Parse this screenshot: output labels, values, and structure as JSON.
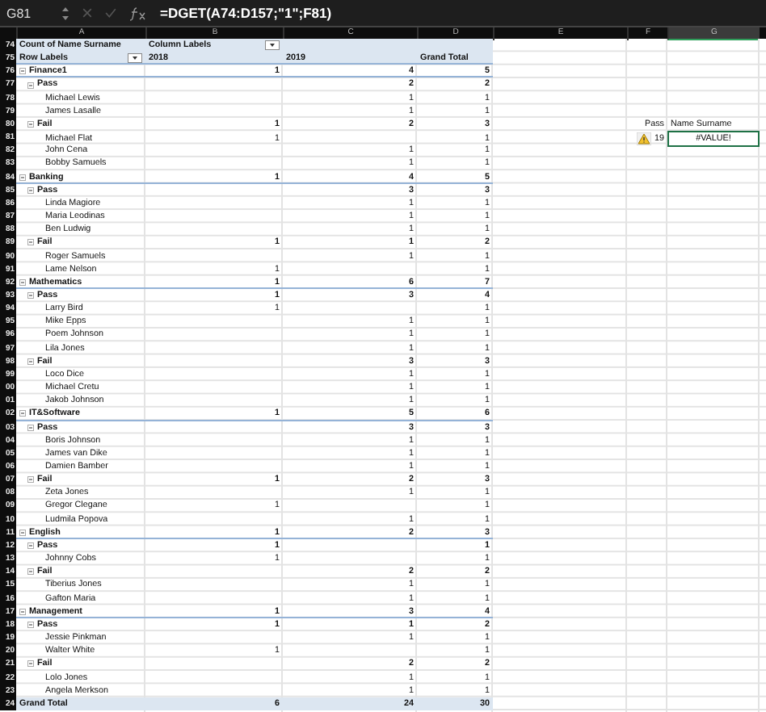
{
  "formula_bar": {
    "name_box": "G81",
    "formula": "=DGET(A74:D157;\"1\";F81)"
  },
  "columns": [
    {
      "label": "A",
      "selected": false
    },
    {
      "label": "B",
      "selected": false
    },
    {
      "label": "C",
      "selected": false
    },
    {
      "label": "D",
      "selected": false
    },
    {
      "label": "E",
      "selected": false
    },
    {
      "label": "F",
      "selected": false
    },
    {
      "label": "G",
      "selected": true
    }
  ],
  "pivot": {
    "header": {
      "row_number": "74",
      "title": "Count of Name Surname",
      "column_labels": "Column Labels"
    },
    "subheader": {
      "row_number": "75",
      "row_labels": "Row Labels",
      "years": [
        "2018",
        "2019"
      ],
      "grand_total": "Grand Total"
    },
    "rows": [
      {
        "row_number": "76",
        "label": "Finance1",
        "expanded": true,
        "values": {
          "y2018": "1",
          "y2019": "4",
          "total": "5"
        },
        "children": [
          {
            "row_number": "77",
            "label": "Pass",
            "expanded": true,
            "values": {
              "y2019": "2",
              "total": "2"
            },
            "children": [
              {
                "row_number": "78",
                "label": "Michael Lewis",
                "values": {
                  "y2019": "1",
                  "total": "1"
                }
              },
              {
                "row_number": "79",
                "label": "James Lasalle",
                "values": {
                  "y2019": "1",
                  "total": "1"
                }
              }
            ]
          },
          {
            "row_number": "80",
            "label": "Fail",
            "expanded": true,
            "values": {
              "y2018": "1",
              "y2019": "2",
              "total": "3"
            },
            "side": {
              "f": "Pass",
              "g": "Name Surname"
            },
            "children": [
              {
                "row_number": "81",
                "label": "Michael Flat",
                "values": {
                  "y2018": "1",
                  "total": "1"
                },
                "side": {
                  "f": "19",
                  "g": "#VALUE!",
                  "warning": true,
                  "selected": true
                }
              },
              {
                "row_number": "82",
                "label": "John Cena",
                "values": {
                  "y2019": "1",
                  "total": "1"
                }
              },
              {
                "row_number": "83",
                "label": "Bobby Samuels",
                "values": {
                  "y2019": "1",
                  "total": "1"
                }
              }
            ]
          }
        ]
      },
      {
        "row_number": "84",
        "label": "Banking",
        "expanded": true,
        "values": {
          "y2018": "1",
          "y2019": "4",
          "total": "5"
        },
        "children": [
          {
            "row_number": "85",
            "label": "Pass",
            "expanded": true,
            "values": {
              "y2019": "3",
              "total": "3"
            },
            "children": [
              {
                "row_number": "86",
                "label": "Linda Magiore",
                "values": {
                  "y2019": "1",
                  "total": "1"
                }
              },
              {
                "row_number": "87",
                "label": "Maria Leodinas",
                "values": {
                  "y2019": "1",
                  "total": "1"
                }
              },
              {
                "row_number": "88",
                "label": "Ben Ludwig",
                "values": {
                  "y2019": "1",
                  "total": "1"
                }
              }
            ]
          },
          {
            "row_number": "89",
            "label": "Fail",
            "expanded": true,
            "values": {
              "y2018": "1",
              "y2019": "1",
              "total": "2"
            },
            "children": [
              {
                "row_number": "90",
                "label": "Roger Samuels",
                "values": {
                  "y2019": "1",
                  "total": "1"
                }
              },
              {
                "row_number": "91",
                "label": "Lame Nelson",
                "values": {
                  "y2018": "1",
                  "total": "1"
                }
              }
            ]
          }
        ]
      },
      {
        "row_number": "92",
        "label": "Mathematics",
        "expanded": true,
        "values": {
          "y2018": "1",
          "y2019": "6",
          "total": "7"
        },
        "children": [
          {
            "row_number": "93",
            "label": "Pass",
            "expanded": true,
            "values": {
              "y2018": "1",
              "y2019": "3",
              "total": "4"
            },
            "children": [
              {
                "row_number": "94",
                "label": "Larry Bird",
                "values": {
                  "y2018": "1",
                  "total": "1"
                }
              },
              {
                "row_number": "95",
                "label": "Mike Epps",
                "values": {
                  "y2019": "1",
                  "total": "1"
                }
              },
              {
                "row_number": "96",
                "label": "Poem Johnson",
                "values": {
                  "y2019": "1",
                  "total": "1"
                }
              },
              {
                "row_number": "97",
                "label": "Lila Jones",
                "values": {
                  "y2019": "1",
                  "total": "1"
                }
              }
            ]
          },
          {
            "row_number": "98",
            "label": "Fail",
            "expanded": true,
            "values": {
              "y2019": "3",
              "total": "3"
            },
            "children": [
              {
                "row_number": "99",
                "label": "Loco Dice",
                "values": {
                  "y2019": "1",
                  "total": "1"
                }
              },
              {
                "row_number": "00",
                "label": "Michael Cretu",
                "values": {
                  "y2019": "1",
                  "total": "1"
                }
              },
              {
                "row_number": "01",
                "label": "Jakob Johnson",
                "values": {
                  "y2019": "1",
                  "total": "1"
                }
              }
            ]
          }
        ]
      },
      {
        "row_number": "02",
        "label": "IT&Software",
        "expanded": true,
        "values": {
          "y2018": "1",
          "y2019": "5",
          "total": "6"
        },
        "children": [
          {
            "row_number": "03",
            "label": "Pass",
            "expanded": true,
            "values": {
              "y2019": "3",
              "total": "3"
            },
            "children": [
              {
                "row_number": "04",
                "label": "Boris Johnson",
                "values": {
                  "y2019": "1",
                  "total": "1"
                }
              },
              {
                "row_number": "05",
                "label": "James van Dike",
                "values": {
                  "y2019": "1",
                  "total": "1"
                }
              },
              {
                "row_number": "06",
                "label": "Damien Bamber",
                "values": {
                  "y2019": "1",
                  "total": "1"
                }
              }
            ]
          },
          {
            "row_number": "07",
            "label": "Fail",
            "expanded": true,
            "values": {
              "y2018": "1",
              "y2019": "2",
              "total": "3"
            },
            "children": [
              {
                "row_number": "08",
                "label": "Zeta Jones",
                "values": {
                  "y2019": "1",
                  "total": "1"
                }
              },
              {
                "row_number": "09",
                "label": "Gregor Clegane",
                "values": {
                  "y2018": "1",
                  "total": "1"
                }
              },
              {
                "row_number": "10",
                "label": "Ludmila Popova",
                "values": {
                  "y2019": "1",
                  "total": "1"
                }
              }
            ]
          }
        ]
      },
      {
        "row_number": "11",
        "label": "English",
        "expanded": true,
        "values": {
          "y2018": "1",
          "y2019": "2",
          "total": "3"
        },
        "children": [
          {
            "row_number": "12",
            "label": "Pass",
            "expanded": true,
            "values": {
              "y2018": "1",
              "total": "1"
            },
            "children": [
              {
                "row_number": "13",
                "label": "Johnny Cobs",
                "values": {
                  "y2018": "1",
                  "total": "1"
                }
              }
            ]
          },
          {
            "row_number": "14",
            "label": "Fail",
            "expanded": true,
            "values": {
              "y2019": "2",
              "total": "2"
            },
            "children": [
              {
                "row_number": "15",
                "label": "Tiberius Jones",
                "values": {
                  "y2019": "1",
                  "total": "1"
                }
              },
              {
                "row_number": "16",
                "label": "Gafton Maria",
                "values": {
                  "y2019": "1",
                  "total": "1"
                }
              }
            ]
          }
        ]
      },
      {
        "row_number": "17",
        "label": "Management",
        "expanded": true,
        "values": {
          "y2018": "1",
          "y2019": "3",
          "total": "4"
        },
        "children": [
          {
            "row_number": "18",
            "label": "Pass",
            "expanded": true,
            "values": {
              "y2018": "1",
              "y2019": "1",
              "total": "2"
            },
            "children": [
              {
                "row_number": "19",
                "label": "Jessie Pinkman",
                "values": {
                  "y2019": "1",
                  "total": "1"
                }
              },
              {
                "row_number": "20",
                "label": "Walter White",
                "values": {
                  "y2018": "1",
                  "total": "1"
                }
              }
            ]
          },
          {
            "row_number": "21",
            "label": "Fail",
            "expanded": true,
            "values": {
              "y2019": "2",
              "total": "2"
            },
            "children": [
              {
                "row_number": "22",
                "label": "Lolo Jones",
                "values": {
                  "y2019": "1",
                  "total": "1"
                }
              },
              {
                "row_number": "23",
                "label": "Angela Merkson",
                "values": {
                  "y2019": "1",
                  "total": "1"
                }
              }
            ]
          }
        ]
      }
    ],
    "grand_total": {
      "row_number": "24",
      "label": "Grand Total",
      "values": {
        "y2018": "6",
        "y2019": "24",
        "total": "30"
      }
    }
  }
}
